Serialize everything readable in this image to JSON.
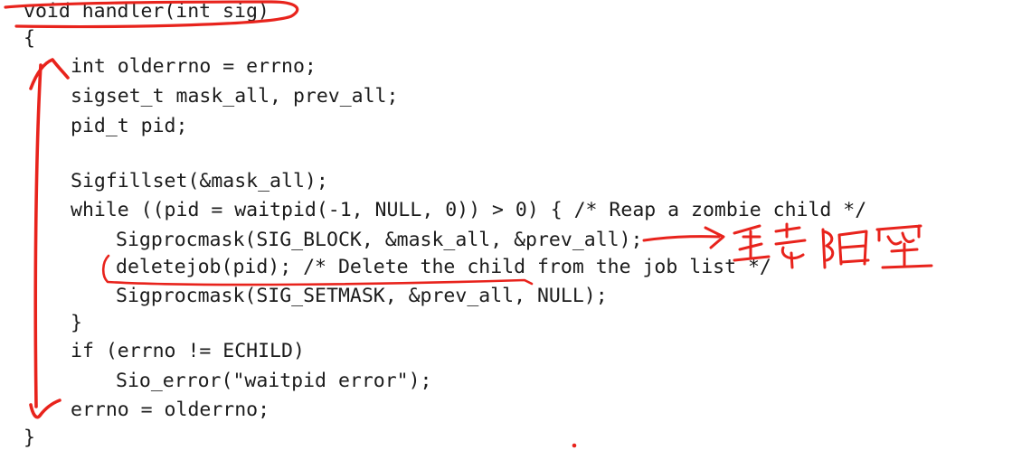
{
  "code": {
    "lines": [
      "void handler(int sig)",
      "{",
      "int olderrno = errno;",
      "sigset_t mask_all, prev_all;",
      "pid_t pid;",
      "",
      "Sigfillset(&mask_all);",
      "while ((pid = waitpid(-1, NULL, 0)) > 0) { /* Reap a zombie child */",
      "Sigprocmask(SIG_BLOCK, &mask_all, &prev_all);",
      "deletejob(pid); /* Delete the child from the job list */",
      "Sigprocmask(SIG_SETMASK, &prev_all, NULL);",
      "}",
      "if (errno != ECHILD)",
      "Sio_error(\"waitpid error\");",
      "errno = olderrno;",
      "}"
    ]
  },
  "annotations": {
    "ink_color": "#e8231c",
    "note_text": "全部阻塞"
  }
}
